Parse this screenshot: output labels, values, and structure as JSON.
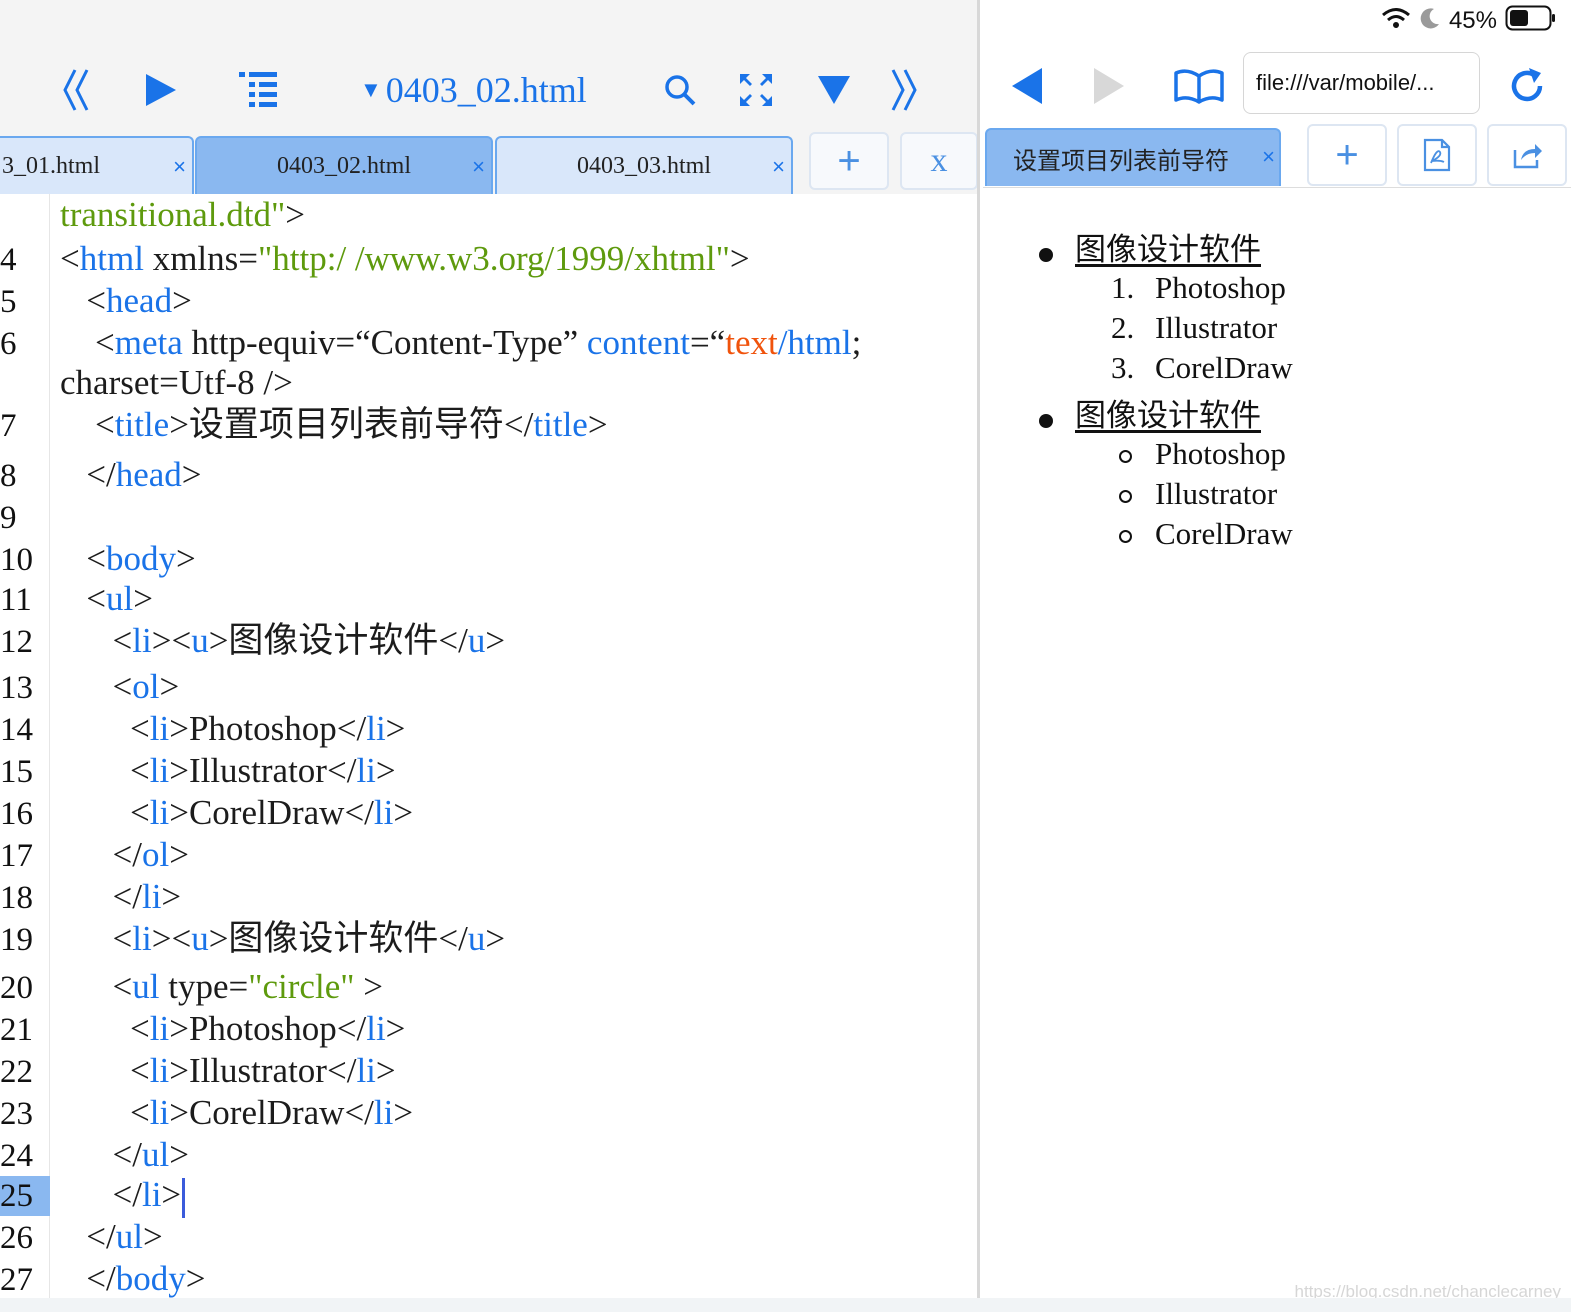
{
  "status_bar": {
    "battery_percent": "45%"
  },
  "editor": {
    "toolbar": {
      "file_title": "0403_02.html",
      "icons": [
        "double-left-icon",
        "play-icon",
        "outline-icon",
        "search-icon",
        "fullscreen-icon",
        "dropdown-triangle-icon",
        "double-right-icon"
      ]
    },
    "tabs": [
      {
        "label": "3_01.html",
        "close": "×",
        "active": false
      },
      {
        "label": "0403_02.html",
        "close": "×",
        "active": true
      },
      {
        "label": "0403_03.html",
        "close": "×",
        "active": false
      }
    ],
    "add_tab_label": "+",
    "close_all_label": "x",
    "current_line": "25",
    "lines": [
      {
        "num": "",
        "segs": [
          [
            "s",
            "transitional.dtd\""
          ],
          [
            "p",
            ">"
          ]
        ]
      },
      {
        "num": "4",
        "segs": [
          [
            "p",
            "<"
          ],
          [
            "t",
            "html"
          ],
          [
            "p",
            " xmlns="
          ],
          [
            "s",
            "\"http:/ /www.w3.org/1999/xhtml\""
          ],
          [
            "p",
            ">"
          ]
        ]
      },
      {
        "num": "5",
        "segs": [
          [
            "p",
            "   <"
          ],
          [
            "t",
            "head"
          ],
          [
            "p",
            ">"
          ]
        ]
      },
      {
        "num": "6",
        "segs": [
          [
            "p",
            "    <"
          ],
          [
            "t",
            "meta"
          ],
          [
            "p",
            " http-equiv=“Content-Type” "
          ],
          [
            "t",
            "content"
          ],
          [
            "p",
            "=“"
          ],
          [
            "o",
            "text"
          ],
          [
            "t",
            "/html"
          ],
          [
            "p",
            ";"
          ]
        ]
      },
      {
        "num": "",
        "segs": [
          [
            "p",
            "charset=Utf-8 />"
          ]
        ]
      },
      {
        "num": "7",
        "segs": [
          [
            "p",
            "    <"
          ],
          [
            "t",
            "title"
          ],
          [
            "p",
            ">设置项目列表前导符</"
          ],
          [
            "t",
            "title"
          ],
          [
            "p",
            ">"
          ]
        ]
      },
      {
        "num": "8",
        "segs": [
          [
            "p",
            "   </"
          ],
          [
            "t",
            "head"
          ],
          [
            "p",
            ">"
          ]
        ]
      },
      {
        "num": "9",
        "segs": []
      },
      {
        "num": "10",
        "segs": [
          [
            "p",
            "   <"
          ],
          [
            "t",
            "body"
          ],
          [
            "p",
            ">"
          ]
        ]
      },
      {
        "num": "11",
        "segs": [
          [
            "p",
            "   <"
          ],
          [
            "t",
            "ul"
          ],
          [
            "p",
            ">"
          ]
        ]
      },
      {
        "num": "12",
        "segs": [
          [
            "p",
            "      <"
          ],
          [
            "t",
            "li"
          ],
          [
            "p",
            "><"
          ],
          [
            "t",
            "u"
          ],
          [
            "p",
            ">图像设计软件</"
          ],
          [
            "t",
            "u"
          ],
          [
            "p",
            ">"
          ]
        ]
      },
      {
        "num": "13",
        "segs": [
          [
            "p",
            "      <"
          ],
          [
            "t",
            "ol"
          ],
          [
            "p",
            ">"
          ]
        ]
      },
      {
        "num": "14",
        "segs": [
          [
            "p",
            "        <"
          ],
          [
            "t",
            "li"
          ],
          [
            "p",
            ">Photoshop</"
          ],
          [
            "t",
            "li"
          ],
          [
            "p",
            ">"
          ]
        ]
      },
      {
        "num": "15",
        "segs": [
          [
            "p",
            "        <"
          ],
          [
            "t",
            "li"
          ],
          [
            "p",
            ">Illustrator</"
          ],
          [
            "t",
            "li"
          ],
          [
            "p",
            ">"
          ]
        ]
      },
      {
        "num": "16",
        "segs": [
          [
            "p",
            "        <"
          ],
          [
            "t",
            "li"
          ],
          [
            "p",
            ">CorelDraw</"
          ],
          [
            "t",
            "li"
          ],
          [
            "p",
            ">"
          ]
        ]
      },
      {
        "num": "17",
        "segs": [
          [
            "p",
            "      </"
          ],
          [
            "t",
            "ol"
          ],
          [
            "p",
            ">"
          ]
        ]
      },
      {
        "num": "18",
        "segs": [
          [
            "p",
            "      </"
          ],
          [
            "t",
            "li"
          ],
          [
            "p",
            ">"
          ]
        ]
      },
      {
        "num": "19",
        "segs": [
          [
            "p",
            "      <"
          ],
          [
            "t",
            "li"
          ],
          [
            "p",
            "><"
          ],
          [
            "t",
            "u"
          ],
          [
            "p",
            ">图像设计软件</"
          ],
          [
            "t",
            "u"
          ],
          [
            "p",
            ">"
          ]
        ]
      },
      {
        "num": "20",
        "segs": [
          [
            "p",
            "      <"
          ],
          [
            "t",
            "ul"
          ],
          [
            "p",
            " type="
          ],
          [
            "s",
            "\"circle\""
          ],
          [
            "p",
            " >"
          ]
        ]
      },
      {
        "num": "21",
        "segs": [
          [
            "p",
            "        <"
          ],
          [
            "t",
            "li"
          ],
          [
            "p",
            ">Photoshop</"
          ],
          [
            "t",
            "li"
          ],
          [
            "p",
            ">"
          ]
        ]
      },
      {
        "num": "22",
        "segs": [
          [
            "p",
            "        <"
          ],
          [
            "t",
            "li"
          ],
          [
            "p",
            ">Illustrator</"
          ],
          [
            "t",
            "li"
          ],
          [
            "p",
            ">"
          ]
        ]
      },
      {
        "num": "23",
        "segs": [
          [
            "p",
            "        <"
          ],
          [
            "t",
            "li"
          ],
          [
            "p",
            ">CorelDraw</"
          ],
          [
            "t",
            "li"
          ],
          [
            "p",
            ">"
          ]
        ]
      },
      {
        "num": "24",
        "segs": [
          [
            "p",
            "      </"
          ],
          [
            "t",
            "ul"
          ],
          [
            "p",
            ">"
          ]
        ]
      },
      {
        "num": "25",
        "segs": [
          [
            "p",
            "      </"
          ],
          [
            "t",
            "li"
          ],
          [
            "p",
            ">"
          ]
        ]
      },
      {
        "num": "26",
        "segs": [
          [
            "p",
            "   </"
          ],
          [
            "t",
            "ul"
          ],
          [
            "p",
            ">"
          ]
        ]
      },
      {
        "num": "27",
        "segs": [
          [
            "p",
            "   </"
          ],
          [
            "t",
            "body"
          ],
          [
            "p",
            ">"
          ]
        ]
      }
    ]
  },
  "browser": {
    "url": "file:///var/mobile/...",
    "tab": {
      "label": "设置项目列表前导符",
      "close": "×"
    },
    "add_tab_label": "+",
    "icons": [
      "back-icon",
      "forward-icon",
      "bookmarks-icon",
      "reload-icon",
      "pdf-icon",
      "share-icon"
    ],
    "page": {
      "sections": [
        {
          "heading": "图像设计软件",
          "list_type": "ordered",
          "items": [
            "Photoshop",
            "Illustrator",
            "CorelDraw"
          ]
        },
        {
          "heading": "图像设计软件",
          "list_type": "circle",
          "items": [
            "Photoshop",
            "Illustrator",
            "CorelDraw"
          ]
        }
      ]
    },
    "watermark": "https://blog.csdn.net/chanclecarney"
  },
  "colors": {
    "accent": "#1a73e8",
    "tag": "#1a73e8",
    "string": "#5e9a0d",
    "keyword": "#f0530c",
    "active_tab": "#8ab8f0"
  }
}
